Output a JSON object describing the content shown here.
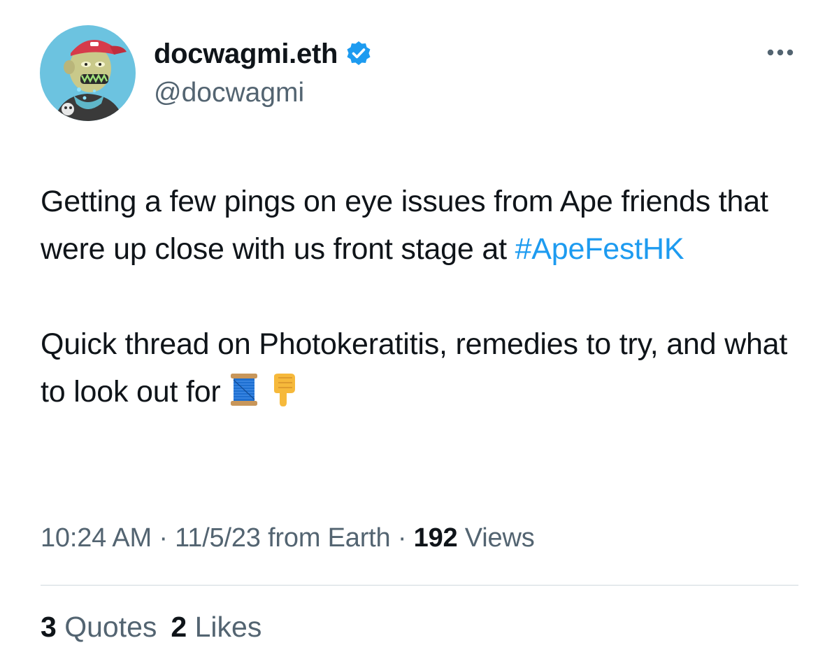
{
  "author": {
    "display_name": "docwagmi.eth",
    "handle": "@docwagmi",
    "verified": true,
    "avatar_icon": "bored-ape-avatar"
  },
  "tweet": {
    "line1_pre": "Getting a few pings on eye issues from Ape friends that were up close with us front stage at ",
    "hashtag": "#ApeFestHK",
    "para2": "Quick thread on Photokeratitis, remedies to try, and what to look out for",
    "emojis": [
      "spool-of-thread-emoji",
      "backhand-index-pointing-down-emoji"
    ]
  },
  "meta": {
    "time": "10:24 AM",
    "sep1": " · ",
    "date": "11/5/23",
    "source": " from Earth",
    "sep2": " · ",
    "views_count": "192",
    "views_label": " Views"
  },
  "engagement": {
    "quotes_count": "3",
    "quotes_label": " Quotes",
    "likes_count": "2",
    "likes_label": " Likes"
  },
  "colors": {
    "text": "#0f1419",
    "secondary": "#536471",
    "link": "#1d9bf0",
    "divider": "#cfd9de"
  }
}
